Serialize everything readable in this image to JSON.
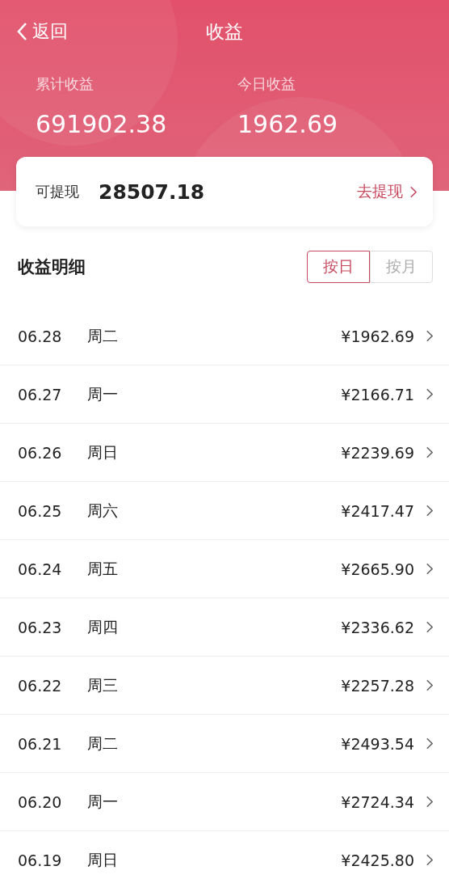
{
  "nav": {
    "back": "返回",
    "title": "收益"
  },
  "summary": [
    {
      "label": "累计收益",
      "value": "691902.38"
    },
    {
      "label": "今日收益",
      "value": "1962.69"
    }
  ],
  "withdraw": {
    "label": "可提现",
    "amount": "28507.18",
    "action": "去提现"
  },
  "details": {
    "title": "收益明细",
    "tabs": [
      {
        "label": "按日",
        "selected": true
      },
      {
        "label": "按月",
        "selected": false
      }
    ]
  },
  "rows": [
    {
      "date": "06.28",
      "weekday": "周二",
      "amount": "¥1962.69"
    },
    {
      "date": "06.27",
      "weekday": "周一",
      "amount": "¥2166.71"
    },
    {
      "date": "06.26",
      "weekday": "周日",
      "amount": "¥2239.69"
    },
    {
      "date": "06.25",
      "weekday": "周六",
      "amount": "¥2417.47"
    },
    {
      "date": "06.24",
      "weekday": "周五",
      "amount": "¥2665.90"
    },
    {
      "date": "06.23",
      "weekday": "周四",
      "amount": "¥2336.62"
    },
    {
      "date": "06.22",
      "weekday": "周三",
      "amount": "¥2257.28"
    },
    {
      "date": "06.21",
      "weekday": "周二",
      "amount": "¥2493.54"
    },
    {
      "date": "06.20",
      "weekday": "周一",
      "amount": "¥2724.34"
    },
    {
      "date": "06.19",
      "weekday": "周日",
      "amount": "¥2425.80"
    }
  ]
}
